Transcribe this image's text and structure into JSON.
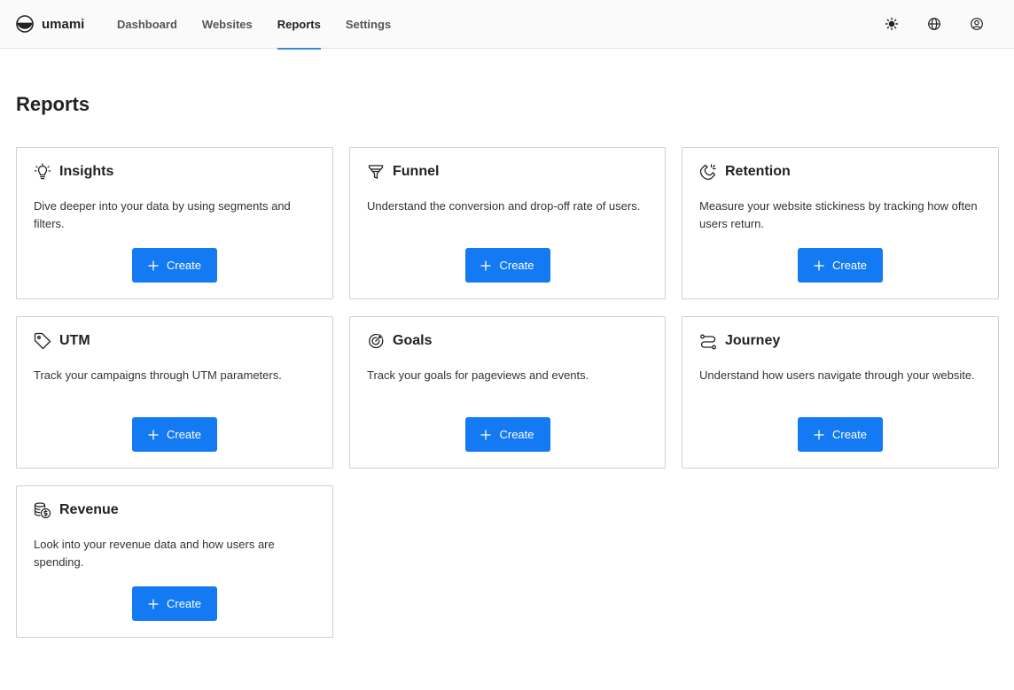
{
  "header": {
    "brand": "umami",
    "nav": [
      {
        "label": "Dashboard",
        "active": false
      },
      {
        "label": "Websites",
        "active": false
      },
      {
        "label": "Reports",
        "active": true
      },
      {
        "label": "Settings",
        "active": false
      }
    ],
    "icons": [
      "sun-icon",
      "globe-icon",
      "user-icon"
    ],
    "active_underline_color": "#3b86d6"
  },
  "page": {
    "title": "Reports"
  },
  "button_color": "#147af3",
  "reports": [
    {
      "title": "Insights",
      "icon": "lightbulb-icon",
      "description": "Dive deeper into your data by using segments and filters.",
      "button": "Create"
    },
    {
      "title": "Funnel",
      "icon": "funnel-icon",
      "description": "Understand the conversion and drop-off rate of users.",
      "button": "Create"
    },
    {
      "title": "Retention",
      "icon": "magnet-icon",
      "description": "Measure your website stickiness by tracking how often users return.",
      "button": "Create"
    },
    {
      "title": "UTM",
      "icon": "tag-icon",
      "description": "Track your campaigns through UTM parameters.",
      "button": "Create"
    },
    {
      "title": "Goals",
      "icon": "target-icon",
      "description": "Track your goals for pageviews and events.",
      "button": "Create"
    },
    {
      "title": "Journey",
      "icon": "route-icon",
      "description": "Understand how users navigate through your website.",
      "button": "Create"
    },
    {
      "title": "Revenue",
      "icon": "coins-icon",
      "description": "Look into your revenue data and how users are spending.",
      "button": "Create"
    }
  ]
}
